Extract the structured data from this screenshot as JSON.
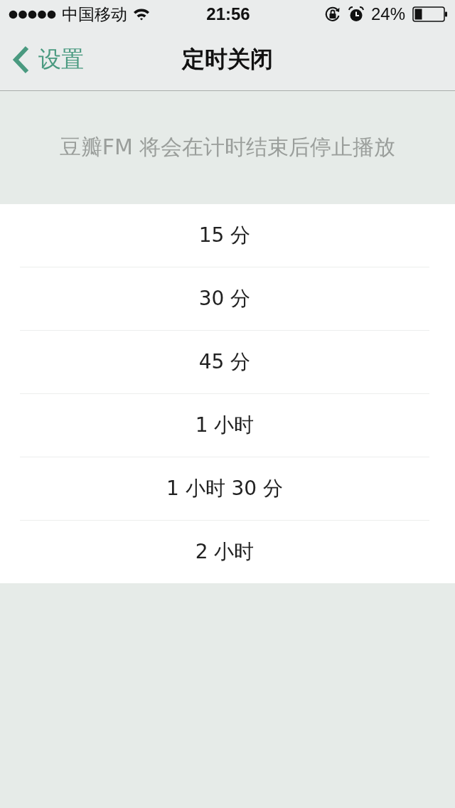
{
  "status_bar": {
    "carrier": "中国移动",
    "time": "21:56",
    "battery": "24%"
  },
  "nav": {
    "back": "设置",
    "title": "定时关闭"
  },
  "description": "豆瓣FM 将会在计时结束后停止播放",
  "options": [
    {
      "label": "15 分"
    },
    {
      "label": "30 分"
    },
    {
      "label": "45 分"
    },
    {
      "label": "1 小时"
    },
    {
      "label": "1 小时 30 分"
    },
    {
      "label": "2 小时"
    }
  ]
}
